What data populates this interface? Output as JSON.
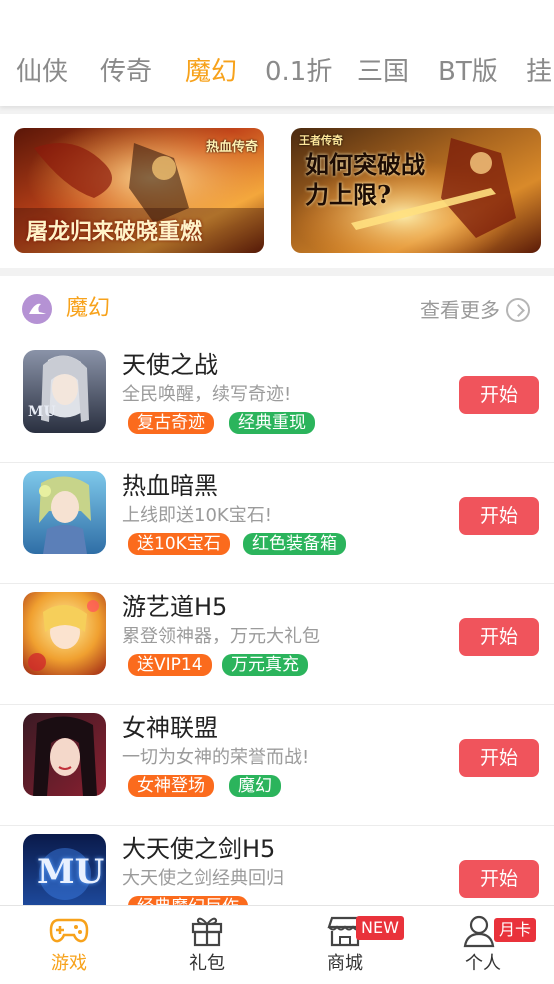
{
  "tabs": [
    {
      "label": "仙侠",
      "active": false
    },
    {
      "label": "传奇",
      "active": false
    },
    {
      "label": "魔幻",
      "active": true
    },
    {
      "label": "0.1折",
      "active": false
    },
    {
      "label": "三国",
      "active": false
    },
    {
      "label": "BT版",
      "active": false
    },
    {
      "label": "挂",
      "active": false
    }
  ],
  "banners": [
    {
      "text": "屠龙归来破晓重燃",
      "logo_text": "热血传奇"
    },
    {
      "text": "如何突破战力上限?",
      "logo_text": "王者传奇"
    }
  ],
  "section": {
    "icon": "wizard-hat-icon",
    "title": "魔幻",
    "more_label": "查看更多"
  },
  "games": [
    {
      "name": "天使之战",
      "desc": "全民唤醒，续写奇迹!",
      "tags": [
        {
          "text": "复古奇迹",
          "color": "orange"
        },
        {
          "text": "经典重现",
          "color": "green"
        }
      ],
      "button": "开始",
      "thumb_text": "MU"
    },
    {
      "name": "热血暗黑",
      "desc": "上线即送10K宝石!",
      "tags": [
        {
          "text": "送10K宝石",
          "color": "orange"
        },
        {
          "text": "红色装备箱",
          "color": "green"
        }
      ],
      "button": "开始",
      "thumb_text": ""
    },
    {
      "name": "游艺道H5",
      "desc": "累登领神器，万元大礼包",
      "tags": [
        {
          "text": "送VIP14",
          "color": "orange"
        },
        {
          "text": "万元真充",
          "color": "green"
        }
      ],
      "button": "开始",
      "thumb_text": ""
    },
    {
      "name": "女神联盟",
      "desc": "一切为女神的荣誉而战!",
      "tags": [
        {
          "text": "女神登场",
          "color": "orange"
        },
        {
          "text": "魔幻",
          "color": "green"
        }
      ],
      "button": "开始",
      "thumb_text": ""
    },
    {
      "name": "大天使之剑H5",
      "desc": "大天使之剑经典回归",
      "tags": [
        {
          "text": "经典魔幻巨作",
          "color": "orange"
        }
      ],
      "button": "开始",
      "thumb_text": "MU"
    }
  ],
  "bottom_nav": [
    {
      "label": "游戏",
      "icon": "gamepad-icon",
      "active": true,
      "badge": ""
    },
    {
      "label": "礼包",
      "icon": "gift-icon",
      "active": false,
      "badge": ""
    },
    {
      "label": "商城",
      "icon": "store-icon",
      "active": false,
      "badge": "NEW"
    },
    {
      "label": "个人",
      "icon": "person-icon",
      "active": false,
      "badge": "月卡"
    }
  ],
  "colors": {
    "accent": "#f7a21b",
    "start_button": "#f0545c",
    "tag_orange": "#fb6b1d",
    "tag_green": "#2bb45c"
  }
}
